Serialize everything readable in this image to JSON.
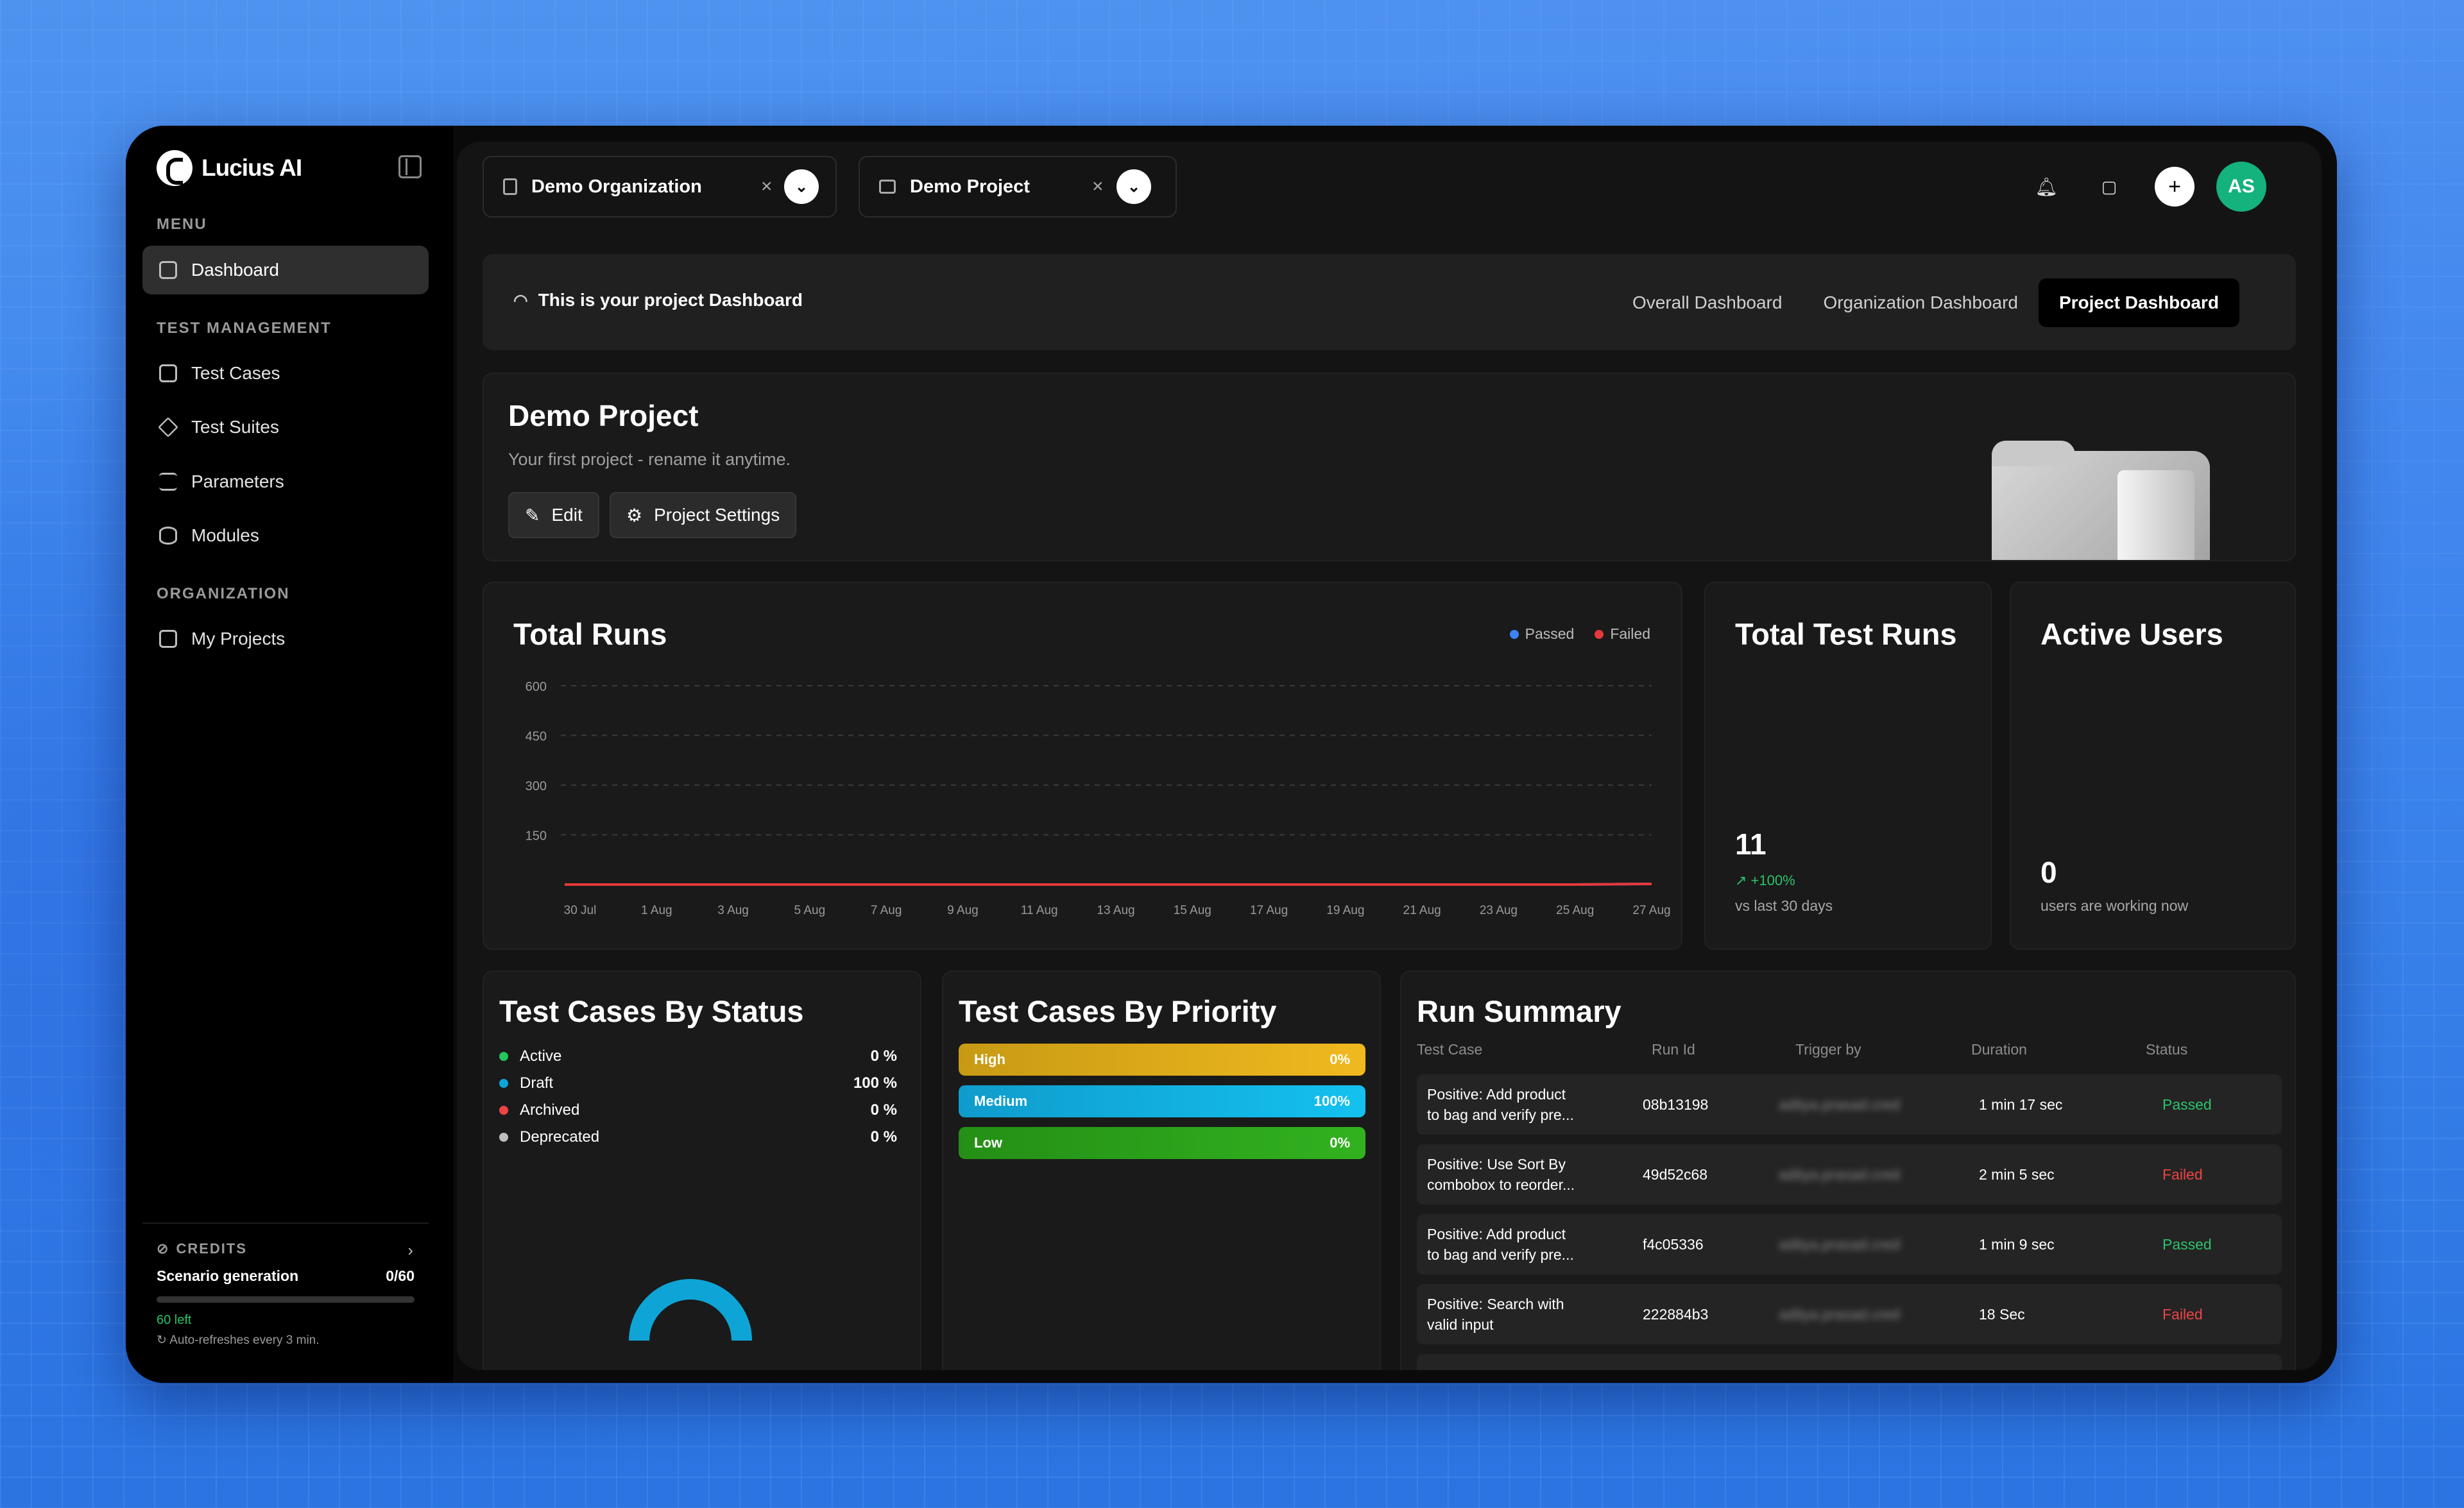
{
  "brand": {
    "name": "Lucius AI"
  },
  "sidebar": {
    "menu_title": "MENU",
    "test_mgmt_title": "TEST MANAGEMENT",
    "org_title": "ORGANIZATION",
    "items": [
      {
        "label": "Dashboard"
      },
      {
        "label": "Test Cases"
      },
      {
        "label": "Test Suites"
      },
      {
        "label": "Parameters"
      },
      {
        "label": "Modules"
      },
      {
        "label": "My Projects"
      }
    ],
    "credits": {
      "title": "CREDITS",
      "label": "Scenario generation",
      "value": "0/60",
      "used_fraction": 0,
      "left": "60 left",
      "auto": "Auto-refreshes every 3 min."
    }
  },
  "topbar": {
    "org": "Demo Organization",
    "project": "Demo Project",
    "avatar": "AS"
  },
  "banner": {
    "text": "This is your project Dashboard",
    "tabs": [
      "Overall Dashboard",
      "Organization Dashboard",
      "Project Dashboard"
    ],
    "active_tab": "Project Dashboard"
  },
  "project": {
    "title": "Demo Project",
    "subtitle": "Your first project - rename it anytime.",
    "edit": "Edit",
    "settings": "Project Settings"
  },
  "total_runs": {
    "title": "Total Runs",
    "legend": [
      {
        "name": "Passed",
        "color": "#3b82f6"
      },
      {
        "name": "Failed",
        "color": "#e5393b"
      }
    ]
  },
  "chart_data": {
    "type": "line",
    "title": "Total Runs",
    "x": [
      "30 Jul",
      "1 Aug",
      "3 Aug",
      "5 Aug",
      "7 Aug",
      "9 Aug",
      "11 Aug",
      "13 Aug",
      "15 Aug",
      "17 Aug",
      "19 Aug",
      "21 Aug",
      "23 Aug",
      "25 Aug",
      "27 Aug"
    ],
    "yticks": [
      150,
      300,
      450,
      600
    ],
    "ylim": [
      0,
      600
    ],
    "series": [
      {
        "name": "Passed",
        "color": "#3b82f6",
        "values": [
          0,
          0,
          0,
          0,
          0,
          0,
          0,
          0,
          0,
          0,
          0,
          0,
          0,
          0,
          2
        ]
      },
      {
        "name": "Failed",
        "color": "#e5393b",
        "values": [
          0,
          0,
          0,
          0,
          0,
          0,
          0,
          0,
          0,
          0,
          0,
          0,
          0,
          0,
          2
        ]
      }
    ],
    "grid": true,
    "legend": "top-right"
  },
  "total_test_runs": {
    "title": "Total Test Runs",
    "value": "11",
    "delta": "+100%",
    "caption": "vs last 30 days"
  },
  "active_users": {
    "title": "Active Users",
    "value": "0",
    "caption": "users are working now"
  },
  "status": {
    "title": "Test Cases By Status",
    "items": [
      {
        "label": "Active",
        "value": "0 %",
        "color": "#22c55e"
      },
      {
        "label": "Draft",
        "value": "100 %",
        "color": "#0ea5d6"
      },
      {
        "label": "Archived",
        "value": "0 %",
        "color": "#ef4444"
      },
      {
        "label": "Deprecated",
        "value": "0 %",
        "color": "#bdbdbd"
      }
    ],
    "gauge_color": "#0ea5d6"
  },
  "priority": {
    "title": "Test Cases By Priority",
    "items": [
      {
        "label": "High",
        "value": "0%",
        "color": "#e3ae1c"
      },
      {
        "label": "Medium",
        "value": "100%",
        "color": "#12b5e5"
      },
      {
        "label": "Low",
        "value": "0%",
        "color": "#2aa11a"
      }
    ]
  },
  "run_summary": {
    "title": "Run Summary",
    "headers": [
      "Test Case",
      "Run Id",
      "Trigger by",
      "Duration",
      "Status"
    ],
    "rows": [
      {
        "case1": "Positive: Add product",
        "case2": "to bag and verify pre...",
        "id": "08b13198",
        "trigger": "aditya.prasad.cred",
        "duration": "1 min 17 sec",
        "status": "Passed"
      },
      {
        "case1": "Positive: Use Sort By",
        "case2": "combobox to reorder...",
        "id": "49d52c68",
        "trigger": "aditya.prasad.cred",
        "duration": "2 min 5 sec",
        "status": "Failed"
      },
      {
        "case1": "Positive: Add product",
        "case2": "to bag and verify pre...",
        "id": "f4c05336",
        "trigger": "aditya.prasad.cred",
        "duration": "1 min 9 sec",
        "status": "Passed"
      },
      {
        "case1": "Positive: Search with",
        "case2": "valid input",
        "id": "222884b3",
        "trigger": "aditya.prasad.cred",
        "duration": "18 Sec",
        "status": "Failed"
      }
    ]
  }
}
